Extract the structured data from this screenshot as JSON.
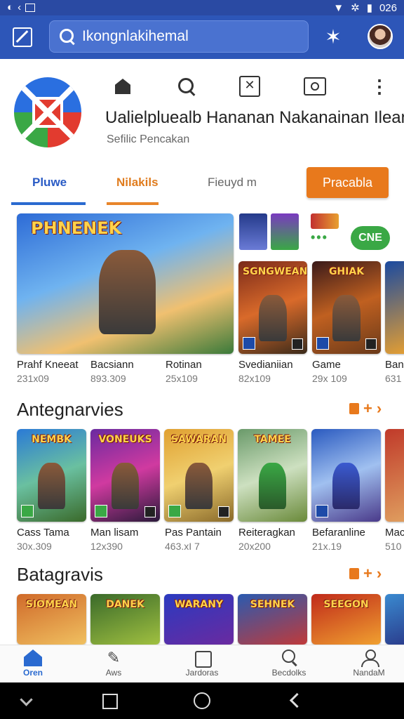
{
  "status_bar": {
    "time": "026"
  },
  "search": {
    "query": "Ikongnlakihemal"
  },
  "app": {
    "title": "Ualielpluealb Hananan Nakanainan Ilean",
    "subtitle": "Sefilic Pencakan"
  },
  "tabs": [
    "Pluwe",
    "Nilakils",
    "Fieuyd m"
  ],
  "primary_button": "Pracabla",
  "featured_count": "CNE",
  "featured": [
    {
      "art": "PHNENEK",
      "name": "Prahf Kneeat",
      "size": "231x09"
    },
    {
      "art": "SGNGWEAN",
      "name": "Bacsiann",
      "size": "893.309"
    },
    {
      "art": "GHIAK",
      "name": "Rotinan",
      "size": "25x109"
    },
    {
      "art": "",
      "name": "Svedianiian",
      "size": "82x109"
    },
    {
      "art": "",
      "name": "Game",
      "size": "29x 109"
    },
    {
      "art": "",
      "name": "Ban",
      "size": "631"
    }
  ],
  "sections": [
    {
      "title": "Antegnarvies",
      "items": [
        {
          "art": "NEMBK",
          "name": "Cass Tama",
          "size": "30x.309"
        },
        {
          "art": "VONEUKS",
          "name": "Man lisam",
          "size": "12x390"
        },
        {
          "art": "SAWARAN",
          "name": "Pas Pantain",
          "size": "463.xI 7"
        },
        {
          "art": "TAMEE",
          "name": "Reiteragkan",
          "size": "20x200"
        },
        {
          "art": "",
          "name": "Befaranline",
          "size": "21x.19"
        },
        {
          "art": "",
          "name": "Mac",
          "size": "510"
        }
      ]
    },
    {
      "title": "Batagravis",
      "items": [
        {
          "art": "SIOMEAN"
        },
        {
          "art": "DANEK"
        },
        {
          "art": "WARANY"
        },
        {
          "art": "SEHNEK"
        },
        {
          "art": "SEEGON"
        },
        {
          "art": ""
        }
      ]
    }
  ],
  "bottom_nav": [
    "Oren",
    "Aws",
    "Jardoras",
    "Becdolks",
    "NandaM"
  ],
  "icons": [
    "edit-icon",
    "search-icon",
    "star-icon",
    "home-icon",
    "close-icon",
    "camera-icon",
    "more-icon"
  ]
}
